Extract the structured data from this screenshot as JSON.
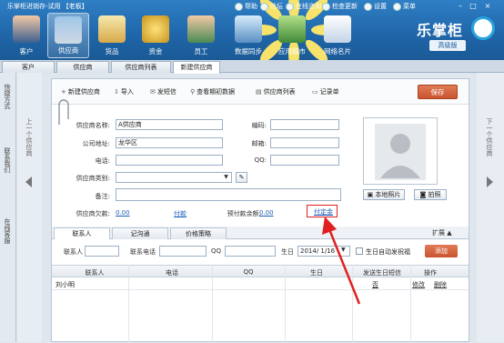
{
  "window": {
    "title": "乐掌柜进销存-试用 【老板】",
    "controls": [
      "帮助",
      "论坛",
      "在线咨询",
      "检查更新",
      "设置",
      "菜单"
    ]
  },
  "nav": [
    {
      "label": "客户"
    },
    {
      "label": "供应商"
    },
    {
      "label": "货品"
    },
    {
      "label": "资金"
    },
    {
      "label": "员工"
    },
    {
      "label": "数据同步"
    },
    {
      "label": "应用超市"
    },
    {
      "label": "网络名片"
    }
  ],
  "brand": {
    "name": "乐掌柜",
    "edition": "高级版"
  },
  "tabs": [
    {
      "label": "客户"
    },
    {
      "label": "供应商"
    },
    {
      "label": "供应商列表"
    },
    {
      "label": "新建供应商"
    }
  ],
  "left_panel": {
    "items": [
      "快捷方式",
      "联系我们",
      "在线客服"
    ]
  },
  "prev_label": "上一个供应商",
  "next_label": "下一个供应商",
  "toolbar": {
    "new": "新建供应商",
    "import": "导入",
    "sms": "发短信",
    "initial": "查看期初数据",
    "list": "供应商列表",
    "records": "记录单",
    "save": "保存"
  },
  "form": {
    "name_label": "供应商名称:",
    "name_value": "A供应商",
    "code_label": "编码:",
    "code_value": "",
    "address_label": "公司地址:",
    "address_value": "龙华区",
    "email_label": "邮箱:",
    "email_value": "",
    "phone_label": "电话:",
    "phone_value": "",
    "qq_label": "QQ:",
    "qq_value": "",
    "category_label": "供应商类别:",
    "category_value": "",
    "remark_label": "备注:",
    "remark_value": "",
    "debt_label": "供应商欠款:",
    "debt_value": "0.00",
    "pay_link": "付款",
    "prepay_label": "预付款余额:",
    "prepay_value": "0.00",
    "deposit_link": "付定金"
  },
  "photo": {
    "local_label": "本地照片",
    "capture_label": "拍照"
  },
  "subtabs": [
    {
      "label": "联系人"
    },
    {
      "label": "记沟通"
    },
    {
      "label": "价格策略"
    }
  ],
  "expand_label": "扩展",
  "contact_form": {
    "name_label": "联系人",
    "phone_label": "联系电话",
    "qq_label": "QQ",
    "birthday_label": "生日",
    "birthday_value": "2014/ 1/16",
    "auto_sms_label": "生日自动发祝福",
    "add_button": "添加"
  },
  "table": {
    "headers": [
      "联系人",
      "电话",
      "QQ",
      "生日",
      "发送生日短信",
      "操作"
    ],
    "rows": [
      {
        "name": "刘小明",
        "phone": "",
        "qq": "",
        "birthday": "",
        "sms": "否",
        "edit": "修改",
        "delete": "删除"
      }
    ]
  },
  "colors": {
    "accent_red": "#e02020",
    "brand_blue": "#1f65a8",
    "save_orange": "#d0603b"
  }
}
